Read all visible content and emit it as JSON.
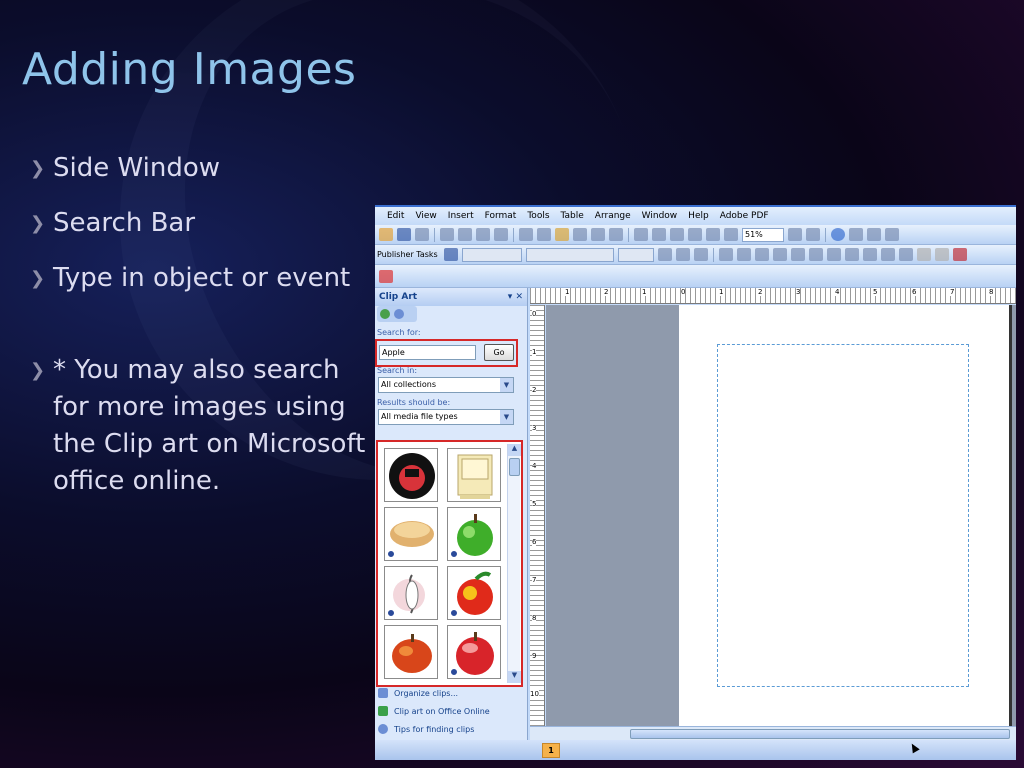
{
  "slide": {
    "title": "Adding Images",
    "bullets": [
      "Side Window",
      "Search Bar",
      "Type in object or event"
    ],
    "note": "* You may also search for more images using the Clip art on Microsoft office online.",
    "bullet_glyph": "❯"
  },
  "publisher": {
    "menu": [
      "Edit",
      "View",
      "Insert",
      "Format",
      "Tools",
      "Table",
      "Arrange",
      "Window",
      "Help",
      "Adobe PDF"
    ],
    "zoom": "51%",
    "task_pane_toggle": "Publisher Tasks",
    "clip_art": {
      "title": "Clip Art",
      "search_for_label": "Search for:",
      "search_value": "Apple",
      "go_label": "Go",
      "search_in_label": "Search in:",
      "search_in_value": "All collections",
      "results_label": "Results should be:",
      "results_value": "All media file types",
      "clips": [
        "apple-logo-clip",
        "computer-clip",
        "apple-pie-clip",
        "green-apple-clip",
        "apple-core-clip",
        "red-apple-clip",
        "apple-clip",
        "shiny-apple-clip"
      ],
      "links": [
        "Organize clips...",
        "Clip art on Office Online",
        "Tips for finding clips"
      ]
    },
    "ruler_h": [
      "1",
      "2",
      "1",
      "0",
      "1",
      "2",
      "3",
      "4",
      "5",
      "6",
      "7",
      "8"
    ],
    "ruler_v": [
      "0",
      "1",
      "2",
      "3",
      "4",
      "5",
      "6",
      "7",
      "8",
      "9",
      "10"
    ],
    "page_number": "1"
  },
  "colors": {
    "title": "#8fc4ea",
    "highlight": "#d62828",
    "office_blue": "#c3daf9"
  }
}
